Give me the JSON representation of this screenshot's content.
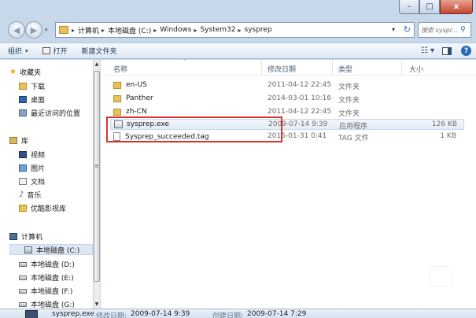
{
  "window": {
    "caption_buttons": {
      "minimize": "–",
      "maximize": "□",
      "close": "x"
    }
  },
  "address": {
    "crumbs": [
      "计算机",
      "本地磁盘 (C:)",
      "Windows",
      "System32",
      "sysprep"
    ],
    "search_placeholder": "搜索 syspr..."
  },
  "toolbar": {
    "organize": "组织",
    "open": "打开",
    "new_folder": "新建文件夹"
  },
  "navigation": {
    "favorites": "收藏夹",
    "favorites_items": [
      "下载",
      "桌面",
      "最近访问的位置"
    ],
    "libraries": "库",
    "libraries_items": [
      "视频",
      "图片",
      "文档",
      "音乐",
      "优酷影视库"
    ],
    "computer": "计算机",
    "drives": [
      "本地磁盘 (C:)",
      "本地磁盘 (D:)",
      "本地磁盘 (E:)",
      "本地磁盘 (F:)",
      "本地磁盘 (G:)"
    ]
  },
  "columns": {
    "name": "名称",
    "date": "修改日期",
    "type": "类型",
    "size": "大小"
  },
  "files": [
    {
      "name": "en-US",
      "date": "2011-04-12 22:45",
      "type": "文件夹",
      "size": "",
      "icon": "folder-icon"
    },
    {
      "name": "Panther",
      "date": "2014-03-01 10:16",
      "type": "文件夹",
      "size": "",
      "icon": "folder-icon"
    },
    {
      "name": "zh-CN",
      "date": "2011-04-12 22:45",
      "type": "文件夹",
      "size": "",
      "icon": "folder-icon"
    },
    {
      "name": "sysprep.exe",
      "date": "2009-07-14 9:39",
      "type": "应用程序",
      "size": "126 KB",
      "icon": "exe-icon"
    },
    {
      "name": "Sysprep_succeeded.tag",
      "date": "2016-01-31 0:41",
      "type": "TAG 文件",
      "size": "1 KB",
      "icon": "file-icon"
    }
  ],
  "details": {
    "filename": "sysprep.exe",
    "modified_label": "修改日期:",
    "modified_value": "2009-07-14 9:39",
    "created_label": "创建日期:",
    "created_value": "2009-07-14 7:29"
  },
  "colors": {
    "highlight_border": "#d9342b",
    "window_frame": "#c6d8ea",
    "selected_nav": "#dde8f4"
  }
}
